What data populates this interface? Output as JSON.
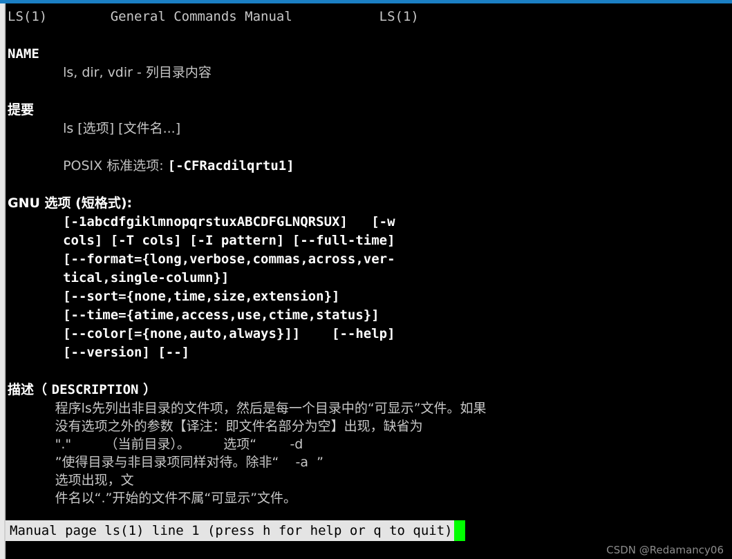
{
  "window": {
    "accent_color": "#1b7fc4",
    "background": "#000000",
    "text_color": "#c8c8c8",
    "bold_color": "#ffffff",
    "cursor_color": "#00ff00",
    "statusbar_bg": "#e4e4e4",
    "statusbar_fg": "#000000"
  },
  "header": {
    "left": "LS(1)",
    "center": "General Commands Manual",
    "right": "LS(1)"
  },
  "sections": {
    "name": {
      "heading": "NAME",
      "body": "ls, dir, vdir - 列目录内容"
    },
    "synopsis": {
      "heading": "提要",
      "usage": "ls [选项] [文件名...]",
      "posix_label": "POSIX 标准选项: ",
      "posix_value": "[-CFRacdilqrtu1]"
    },
    "gnu": {
      "heading": "GNU 选项 (短格式):",
      "lines": [
        "[-1abcdfgiklmnopqrstuxABCDFGLNQRSUX]   [-w",
        "cols] [-T cols] [-I pattern] [--full-time]",
        "[--format={long,verbose,commas,across,ver-",
        "tical,single-column}]",
        "[--sort={none,time,size,extension}]",
        "[--time={atime,access,use,ctime,status}]",
        "[--color[={none,auto,always}]]    [--help]",
        "[--version] [--]"
      ]
    },
    "description": {
      "heading_cjk": "描述（ ",
      "heading_en": "DESCRIPTION",
      "heading_tail": " ）",
      "lines": [
        "程序ls先列出非目录的文件项，然后是每一个目录中的“可显示”文件。如果",
        "没有选项之外的参数【译注：即文件名部分为空】出现，缺省为",
        "\".\"        （当前目录）。        选项“        -d",
        "”使得目录与非目录项同样对待。除非“    -a  ”",
        "选项出现，文",
        "件名以“.”开始的文件不属“可显示”文件。"
      ]
    }
  },
  "status": {
    "text": "Manual page ls(1) line 1 (press h for help or q to quit)",
    "cursor": ""
  },
  "watermark": "CSDN @Redamancy06"
}
